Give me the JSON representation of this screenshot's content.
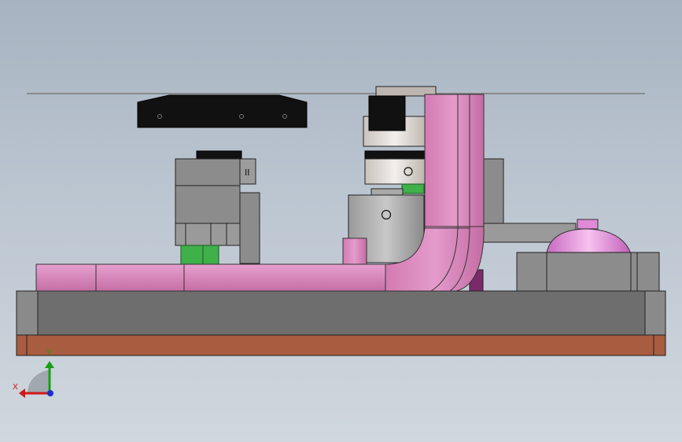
{
  "viewport": {
    "colors": {
      "background_top": "#a7b3c1",
      "background_bottom": "#d0d7de"
    }
  },
  "triad": {
    "x_label": "X",
    "y_label": "Y",
    "colors": {
      "x": "#d01818",
      "y": "#16a016",
      "z": "#1a2fd0"
    }
  },
  "model": {
    "colors": {
      "base_plate": "#6e6e6e",
      "base_bottom": "#a85c40",
      "pink_part": "#d67fb4",
      "pink_dark": "#b86597",
      "gray_part": "#8c8c8c",
      "green_part": "#3fb04a",
      "black_part": "#111111",
      "dome": "#e08ad8"
    }
  }
}
